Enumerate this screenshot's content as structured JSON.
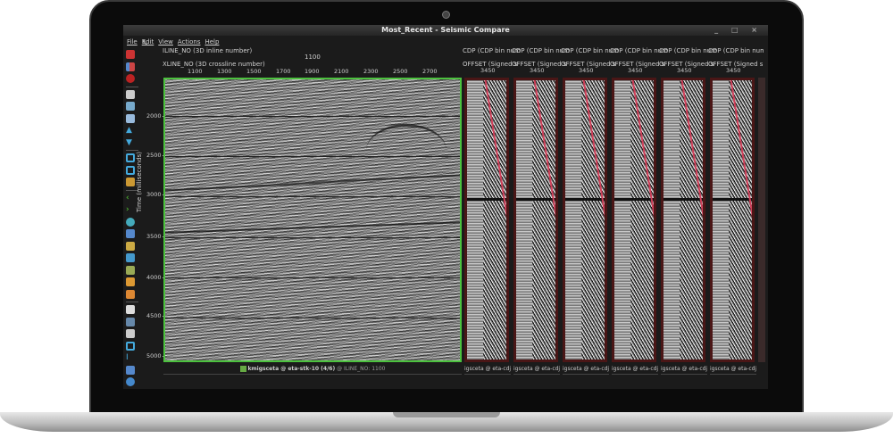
{
  "window": {
    "title": "Most_Recent -  Seismic Compare",
    "controls": "_ □ ×"
  },
  "menu": [
    "File",
    "Edit",
    "View",
    "Actions",
    "Help"
  ],
  "main": {
    "inline_label": "ILINE_NO (3D inline number)",
    "inline_value": "1100",
    "xline_label": "XLINE_NO (3D crossline number)",
    "x_ticks": [
      "1100",
      "1300",
      "1500",
      "1700",
      "1900",
      "2100",
      "2300",
      "2500",
      "2700"
    ],
    "y_axis_label": "Time (milliseconds)",
    "y_ticks": [
      "2000",
      "2500",
      "3000",
      "3500",
      "4000",
      "4500",
      "5000"
    ],
    "footer_dataset": "kmigsceta @ eta-stk-10 (4/6)",
    "footer_line": "@  ILINE_NO: 1100"
  },
  "gathers": [
    {
      "cdp": "CDP (CDP bin num",
      "offset": "OFFSET (Signed s",
      "value": "3450",
      "footer": "igsceta @ eta-cdj"
    },
    {
      "cdp": "CDP (CDP bin num",
      "offset": "OFFSET (Signed s",
      "value": "3450",
      "footer": "igsceta @ eta-cdj"
    },
    {
      "cdp": "CDP (CDP bin num",
      "offset": "OFFSET (Signed s",
      "value": "3450",
      "footer": "igsceta @ eta-cdj"
    },
    {
      "cdp": "CDP (CDP bin num",
      "offset": "OFFSET (Signed s",
      "value": "3450",
      "footer": "igsceta @ eta-cdj"
    },
    {
      "cdp": "CDP (CDP bin num",
      "offset": "OFFSET (Signed s",
      "value": "3450",
      "footer": "igsceta @ eta-cdj"
    },
    {
      "cdp": "CDP (CDP bin num",
      "offset": "OFFSET (Signed s",
      "value": "3450",
      "footer": "igsceta @ eta-cdj"
    }
  ],
  "colors": {
    "active_border": "#4cc23e",
    "gather_border": "#4a1616",
    "moveline": "#d0405a"
  }
}
